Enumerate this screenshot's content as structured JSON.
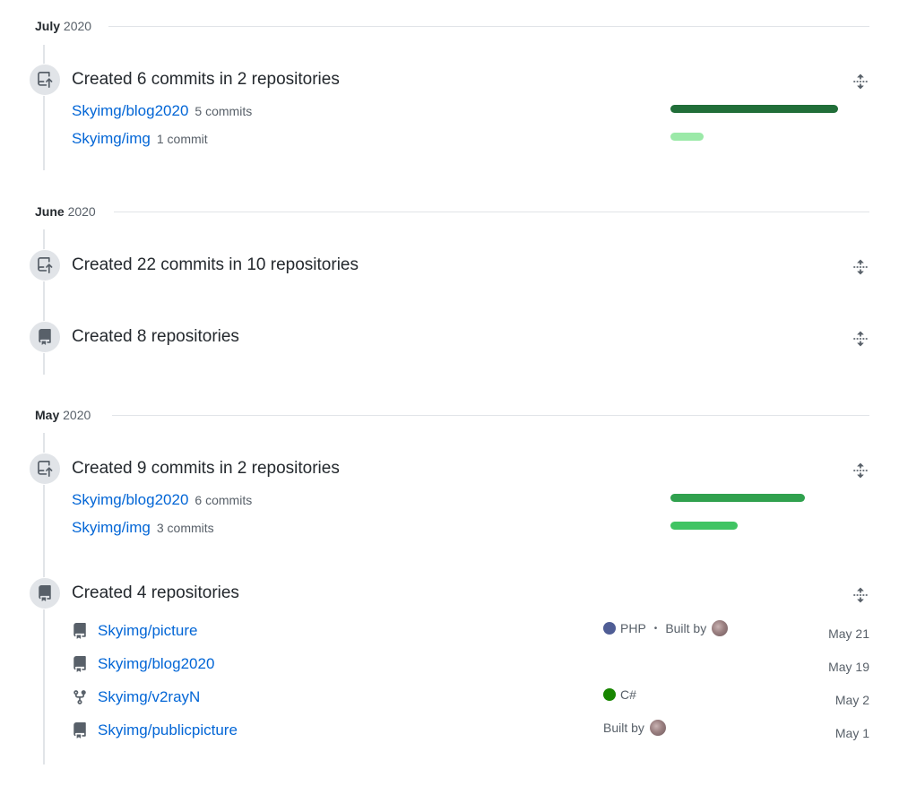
{
  "colors": {
    "link": "#0366d6",
    "text": "#24292e",
    "muted": "#586069",
    "border": "#e1e4e8",
    "bar_dark": "#216e39",
    "bar_medium": "#30a14e",
    "bar_light": "#40c463",
    "bar_pale": "#9be9a8",
    "lang_php": "#4F5D95",
    "lang_csharp": "#178600"
  },
  "months": [
    {
      "name": "July",
      "year": "2020",
      "events": [
        {
          "icon": "repo-push-icon",
          "title": "Created 6 commits in 2 repositories",
          "repos": [
            {
              "name": "Skyimg/blog2020",
              "commits": "5 commits",
              "bar_fraction": 1.0
            },
            {
              "name": "Skyimg/img",
              "commits": "1 commit",
              "bar_fraction": 0.2
            }
          ]
        }
      ]
    },
    {
      "name": "June",
      "year": "2020",
      "events": [
        {
          "icon": "repo-push-icon",
          "title": "Created 22 commits in 10 repositories"
        },
        {
          "icon": "repo-icon",
          "title": "Created 8 repositories"
        }
      ]
    },
    {
      "name": "May",
      "year": "2020",
      "events": [
        {
          "icon": "repo-push-icon",
          "title": "Created 9 commits in 2 repositories",
          "repos": [
            {
              "name": "Skyimg/blog2020",
              "commits": "6 commits",
              "bar_fraction": 0.8
            },
            {
              "name": "Skyimg/img",
              "commits": "3 commits",
              "bar_fraction": 0.4
            }
          ]
        },
        {
          "icon": "repo-icon",
          "title": "Created 4 repositories",
          "created_repos": [
            {
              "icon": "repo-icon",
              "name": "Skyimg/picture",
              "language": "PHP",
              "built_by": "Built by",
              "date": "May 21"
            },
            {
              "icon": "repo-icon",
              "name": "Skyimg/blog2020",
              "date": "May 19"
            },
            {
              "icon": "repo-forked-icon",
              "name": "Skyimg/v2rayN",
              "language": "C#",
              "date": "May 2"
            },
            {
              "icon": "repo-icon",
              "name": "Skyimg/publicpicture",
              "built_by": "Built by",
              "date": "May 1"
            }
          ]
        }
      ]
    }
  ]
}
